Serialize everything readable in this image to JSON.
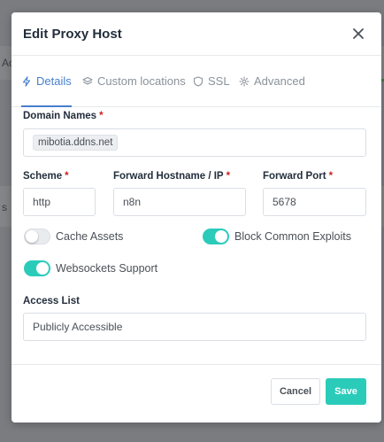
{
  "background": {
    "fragment_top": "Ac",
    "fragment_mid": "s"
  },
  "modal": {
    "title": "Edit Proxy Host",
    "close_icon": "close-icon"
  },
  "tabs": [
    {
      "label": "Details",
      "icon": "bolt-icon",
      "active": true
    },
    {
      "label": "Custom locations",
      "icon": "layers-icon",
      "active": false
    },
    {
      "label": "SSL",
      "icon": "shield-icon",
      "active": false
    },
    {
      "label": "Advanced",
      "icon": "gear-icon",
      "active": false
    }
  ],
  "form": {
    "domain_names": {
      "label": "Domain Names",
      "required": "*",
      "values": [
        "mibotia.ddns.net"
      ]
    },
    "scheme": {
      "label": "Scheme",
      "required": "*",
      "value": "http"
    },
    "forward_hostname": {
      "label": "Forward Hostname / IP",
      "required": "*",
      "value": "n8n"
    },
    "forward_port": {
      "label": "Forward Port",
      "required": "*",
      "value": "5678"
    },
    "toggles": {
      "cache_assets": {
        "label": "Cache Assets",
        "on": false
      },
      "block_exploits": {
        "label": "Block Common Exploits",
        "on": true
      },
      "websockets": {
        "label": "Websockets Support",
        "on": true
      }
    },
    "access_list": {
      "label": "Access List",
      "value": "Publicly Accessible"
    }
  },
  "footer": {
    "cancel_label": "Cancel",
    "save_label": "Save"
  },
  "colors": {
    "accent": "#467fcf",
    "toggle_on": "#2bcbba",
    "save_button": "#2bcbba",
    "required": "#cd201f"
  }
}
